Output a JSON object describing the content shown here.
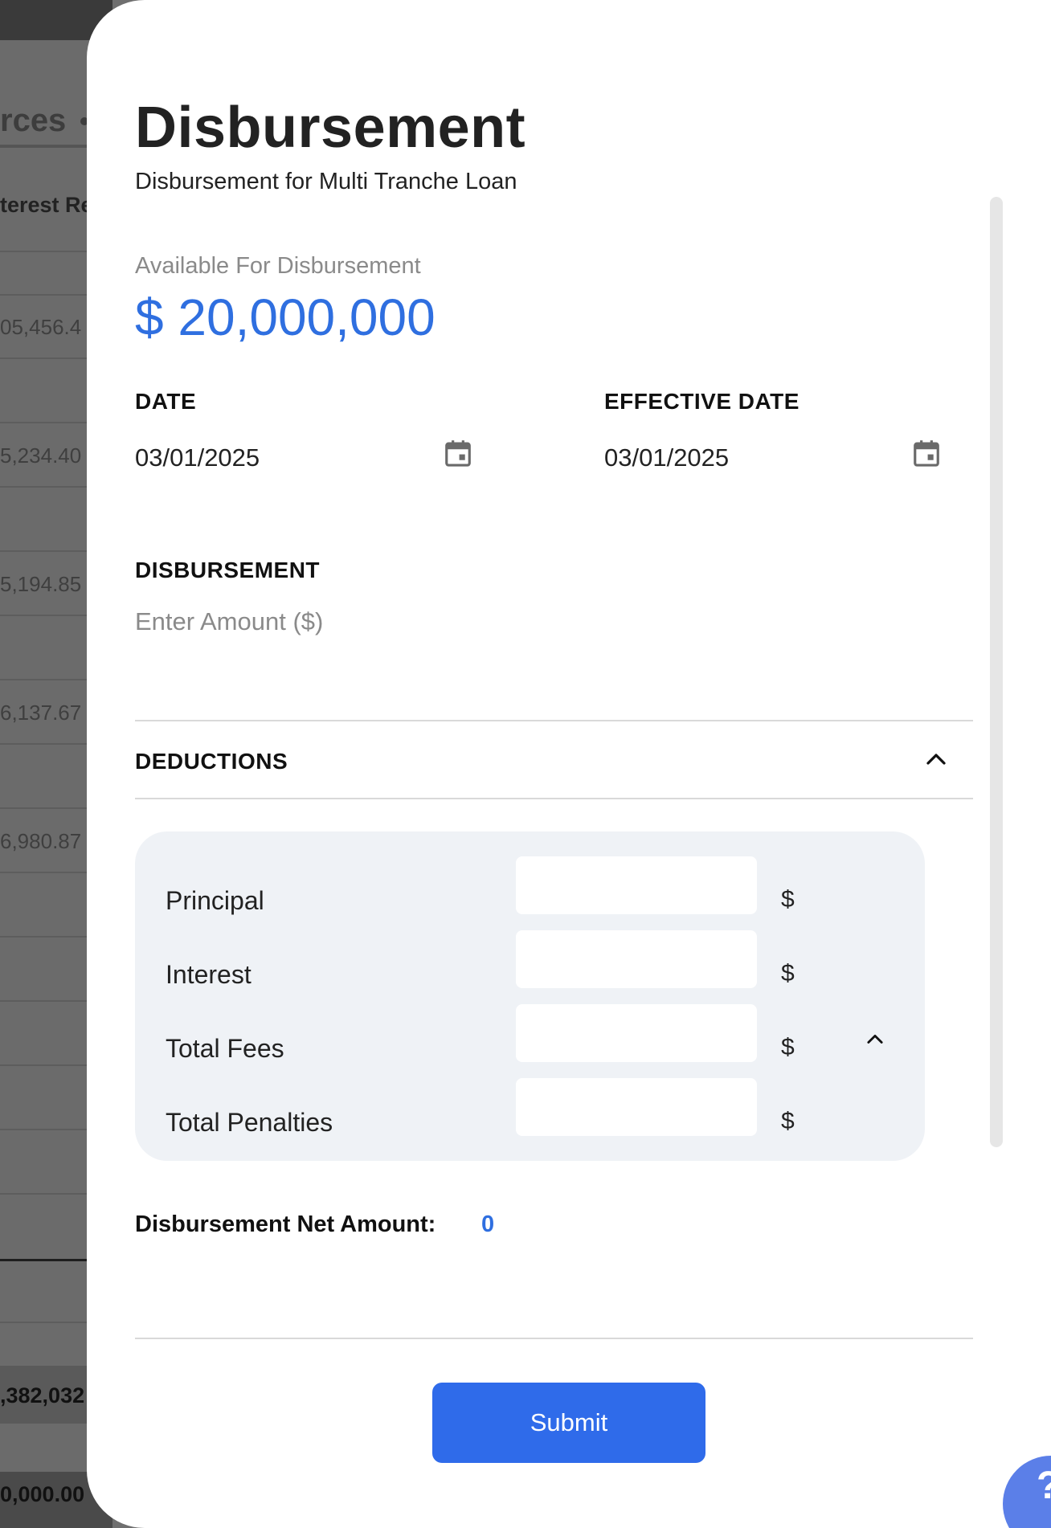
{
  "background": {
    "tab_fragment": "rces",
    "column_header_fragment": "terest Re",
    "row_values": [
      "05,456.4",
      "5,234.40",
      "5,194.85",
      "6,137.67",
      "6,980.87"
    ],
    "total_fragment": ",382,032",
    "bottom_fragment": "0,000.00"
  },
  "modal": {
    "title": "Disbursement",
    "subtitle": "Disbursement for Multi Tranche Loan",
    "available_label": "Available For Disbursement",
    "available_value": "$ 20,000,000",
    "date_label": "DATE",
    "date_value": "03/01/2025",
    "effective_date_label": "EFFECTIVE DATE",
    "effective_date_value": "03/01/2025",
    "disbursement_label": "DISBURSEMENT",
    "amount_placeholder": "Enter Amount ($)",
    "deductions_label": "DEDUCTIONS",
    "deductions": [
      {
        "label": "Principal",
        "currency": "$"
      },
      {
        "label": "Interest",
        "currency": "$"
      },
      {
        "label": "Total Fees",
        "currency": "$"
      },
      {
        "label": "Total Penalties",
        "currency": "$"
      }
    ],
    "net_amount_label": "Disbursement Net Amount:",
    "net_amount_value": "0",
    "submit_label": "Submit",
    "help_glyph": "?"
  },
  "colors": {
    "accent": "#2f6fe0",
    "button": "#2f6bea",
    "deductions_bg": "#eff2f6",
    "overlay": "#6f6f6f"
  },
  "icons": [
    "calendar-icon",
    "chevron-up-icon",
    "help-icon"
  ]
}
